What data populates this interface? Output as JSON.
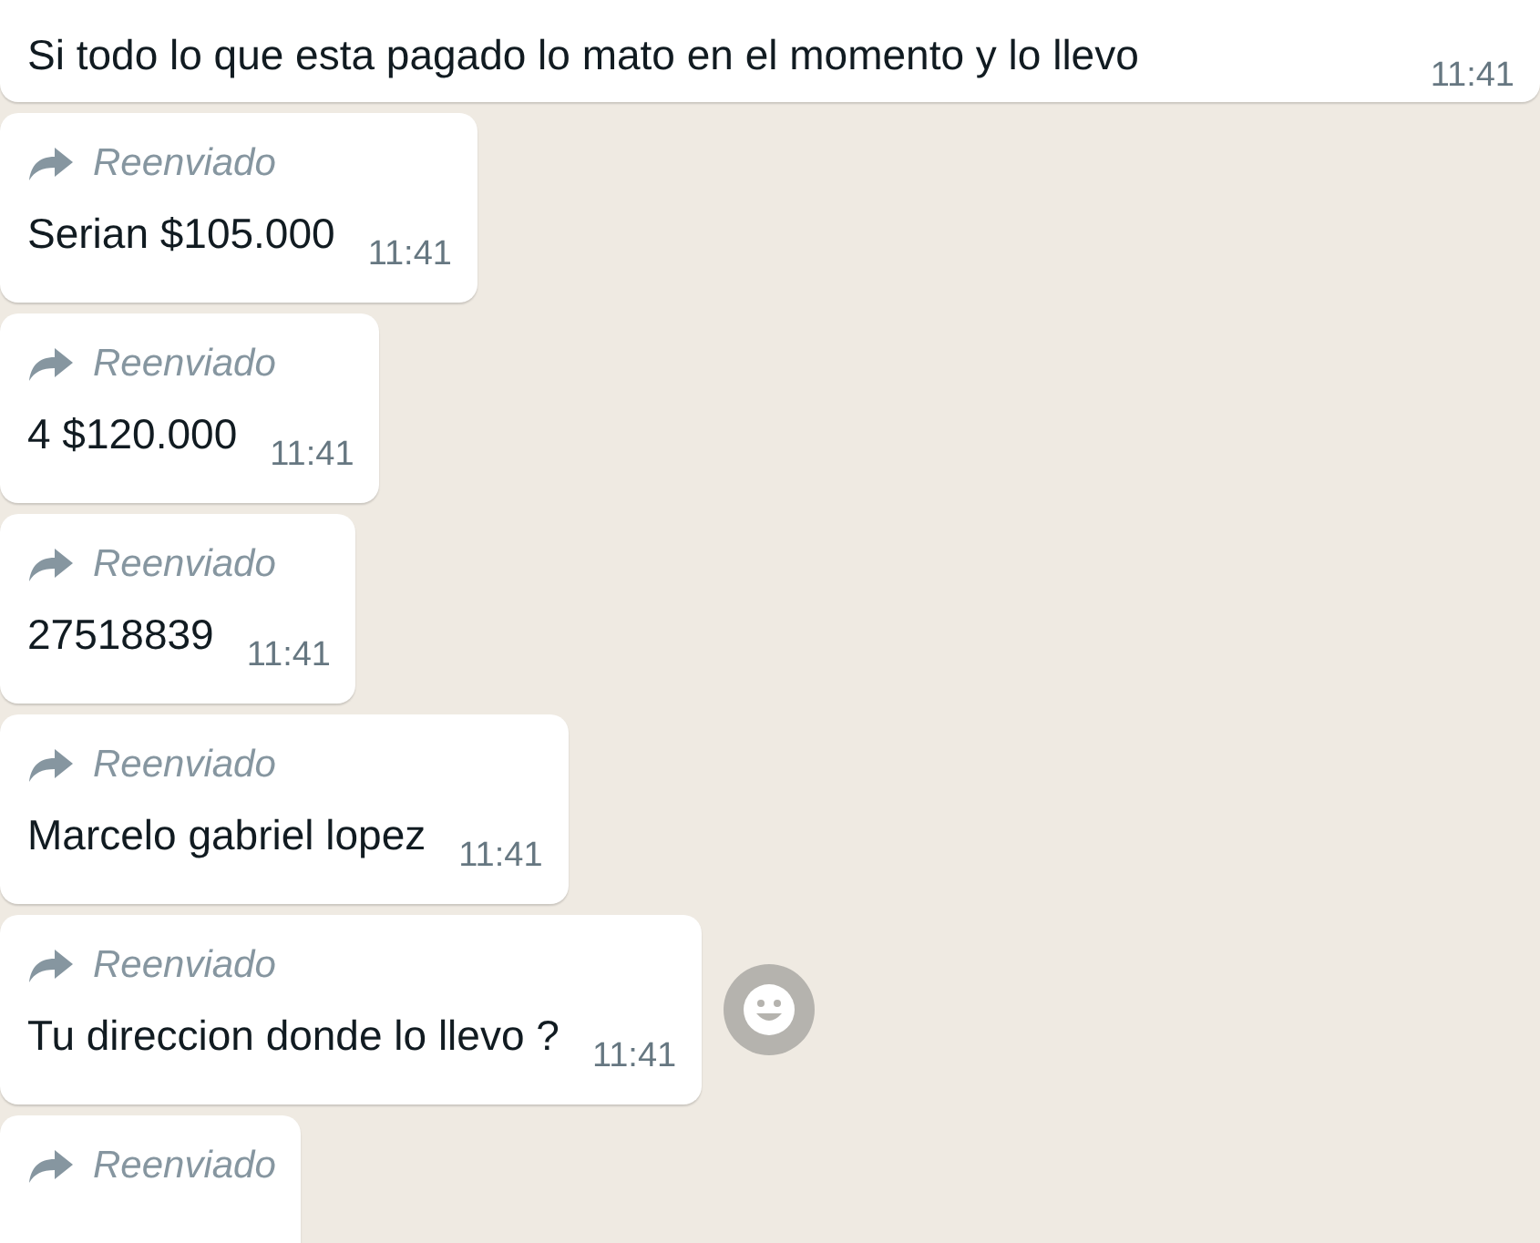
{
  "messages": [
    {
      "forwarded": false,
      "text": "Si todo lo que esta pagado lo mato en el momento y lo llevo",
      "time": "11:41",
      "emoji_button": false
    },
    {
      "forwarded": true,
      "forward_label": "Reenviado",
      "text": "Serian $105.000",
      "time": "11:41",
      "emoji_button": false
    },
    {
      "forwarded": true,
      "forward_label": "Reenviado",
      "text": "4 $120.000",
      "time": "11:41",
      "emoji_button": false
    },
    {
      "forwarded": true,
      "forward_label": "Reenviado",
      "text": "27518839",
      "time": "11:41",
      "emoji_button": false
    },
    {
      "forwarded": true,
      "forward_label": "Reenviado",
      "text": "Marcelo gabriel lopez",
      "time": "11:41",
      "emoji_button": false
    },
    {
      "forwarded": true,
      "forward_label": "Reenviado",
      "text": "Tu direccion donde lo llevo ?",
      "time": "11:41",
      "emoji_button": true
    },
    {
      "forwarded": true,
      "forward_label": "Reenviado",
      "emoji_button": false
    }
  ]
}
